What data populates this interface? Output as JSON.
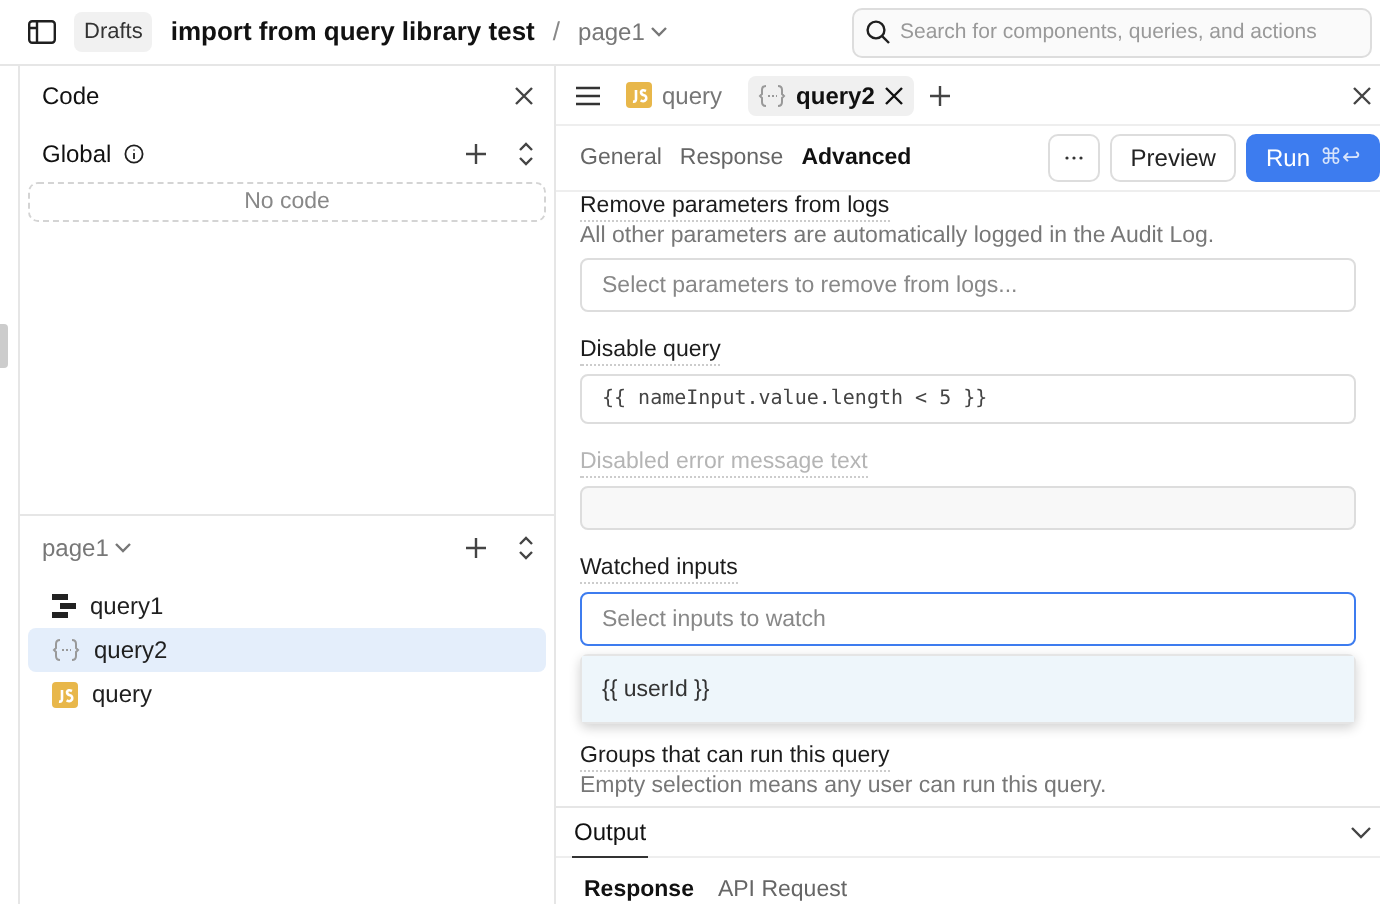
{
  "top_bar": {
    "badge": "Drafts",
    "app_title": "import from query library test",
    "separator": "/",
    "page": "page1",
    "search": {
      "placeholder": "Search for components, queries, and actions"
    }
  },
  "code_panel": {
    "title": "Code",
    "global": {
      "label": "Global",
      "empty_text": "No code"
    },
    "page": {
      "label": "page1",
      "items": [
        {
          "name": "query1",
          "kind": "workflow",
          "selected": false
        },
        {
          "name": "query2",
          "kind": "transformer",
          "selected": true
        },
        {
          "name": "query",
          "kind": "js",
          "selected": false
        }
      ]
    }
  },
  "editor": {
    "tabs": [
      {
        "label": "query",
        "kind": "js",
        "selected": false
      },
      {
        "label": "query2",
        "kind": "transformer",
        "selected": true
      }
    ],
    "subtabs": [
      {
        "label": "General",
        "selected": false
      },
      {
        "label": "Response",
        "selected": false
      },
      {
        "label": "Advanced",
        "selected": true
      }
    ],
    "preview": "Preview",
    "run": "Run",
    "run_shortcut": "⌘↩",
    "fields": [
      {
        "kind": "select",
        "label": "Remove parameters from logs",
        "description": "All other parameters are automatically logged in the Audit Log.",
        "placeholder": "Select parameters to remove from logs...",
        "disabled": false,
        "focused": false
      },
      {
        "kind": "code",
        "label": "Disable query",
        "value": "{{ nameInput.value.length < 5 }}",
        "disabled": false,
        "focused": false
      },
      {
        "kind": "text",
        "label": "Disabled error message text",
        "disabled": true,
        "focused": false
      },
      {
        "kind": "select",
        "label": "Watched inputs",
        "placeholder": "Select inputs to watch",
        "disabled": false,
        "focused": true,
        "options": [
          {
            "label": "{{ userId }}",
            "highlighted": true
          }
        ]
      },
      {
        "kind": "heading",
        "label": "Groups that can run this query",
        "description": "Empty selection means any user can run this query."
      }
    ],
    "output": {
      "title": "Output",
      "tabs": [
        {
          "label": "Response",
          "selected": true
        },
        {
          "label": "API Request",
          "selected": false
        }
      ]
    }
  }
}
